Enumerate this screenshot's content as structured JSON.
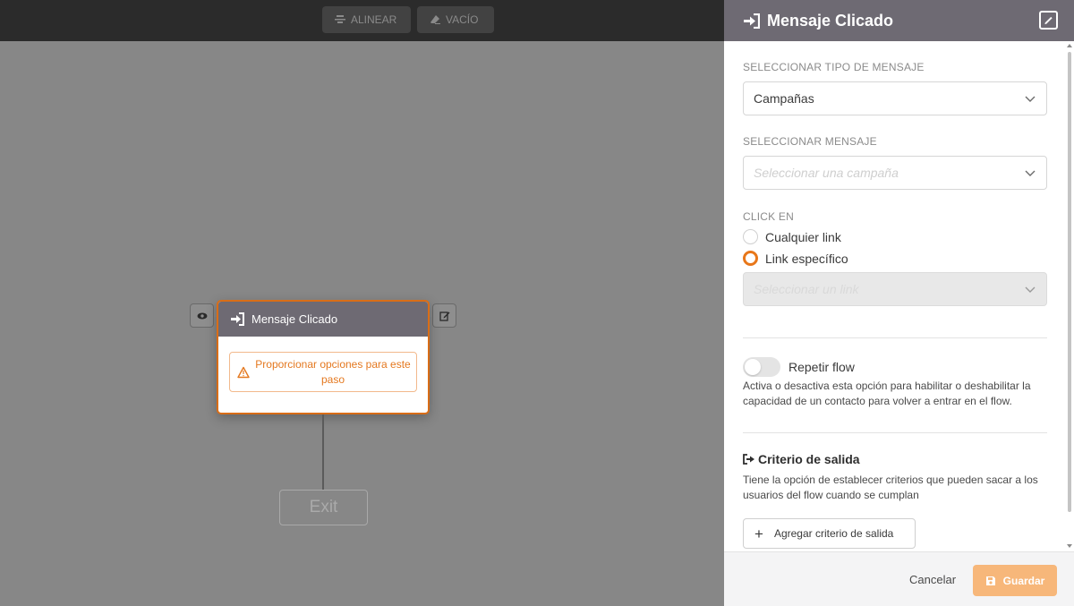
{
  "toolbar": {
    "align_label": "ALINEAR",
    "empty_label": "VACÍO"
  },
  "node": {
    "title": "Mensaje Clicado",
    "warning": "Proporcionar opciones para este paso"
  },
  "exit_node": {
    "label": "Exit"
  },
  "panel": {
    "title": "Mensaje Clicado",
    "message_type": {
      "label": "SELECCIONAR TIPO DE MENSAJE",
      "value": "Campañas"
    },
    "message": {
      "label": "SELECCIONAR MENSAJE",
      "placeholder": "Seleccionar una campaña"
    },
    "click": {
      "label": "CLICK EN",
      "options": [
        {
          "label": "Cualquier link",
          "selected": false
        },
        {
          "label": "Link específico",
          "selected": true
        }
      ],
      "link_placeholder": "Seleccionar un link"
    },
    "repeat": {
      "label": "Repetir flow",
      "enabled": false,
      "help": "Activa o desactiva esta opción para habilitar o deshabilitar la capacidad de un contacto para volver a entrar en el flow."
    },
    "exit_criteria": {
      "title": "Criterio de salida",
      "help": "Tiene la opción de establecer criterios que pueden sacar a los usuarios del flow cuando se cumplan",
      "add_label": "Agregar criterio de salida"
    },
    "footer": {
      "cancel_label": "Cancelar",
      "save_label": "Guardar"
    }
  },
  "colors": {
    "accent": "#e8771a",
    "header": "#6e6a73",
    "save_button": "#f7b77a"
  }
}
